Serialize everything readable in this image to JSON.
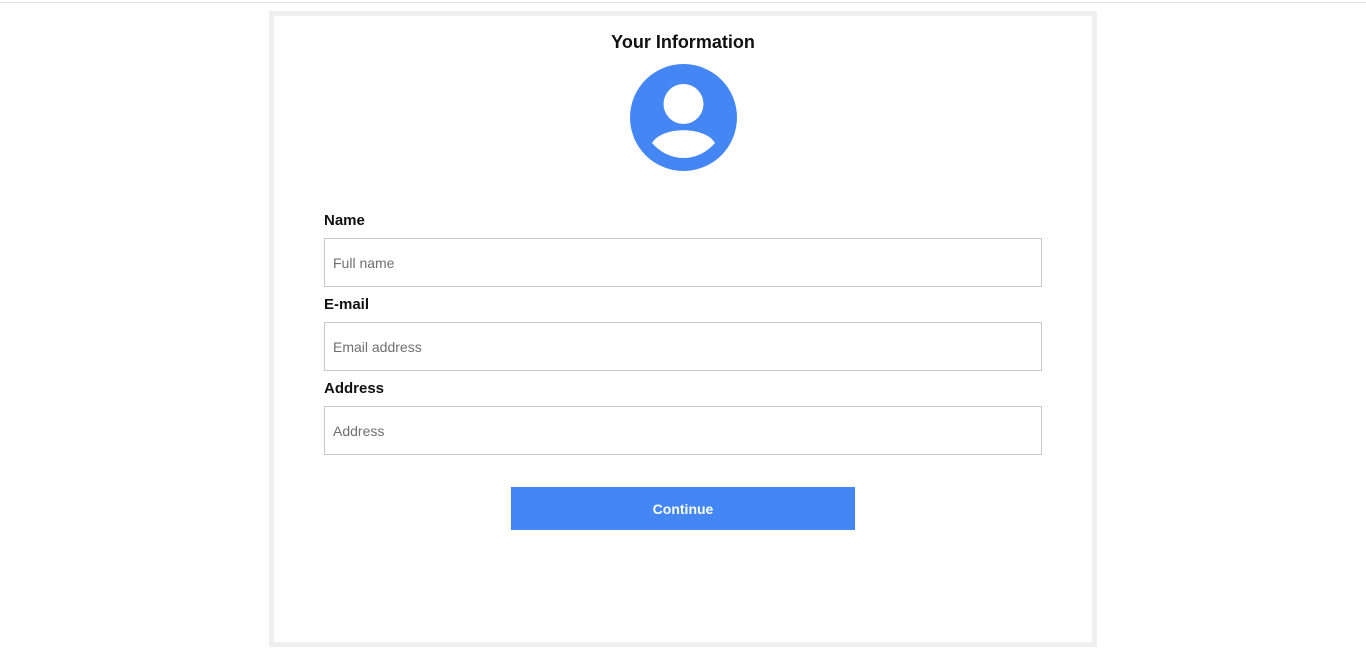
{
  "form": {
    "title": "Your Information",
    "avatar_icon": "user-avatar-icon",
    "accent_color": "#4487f4",
    "fields": [
      {
        "label": "Name",
        "placeholder": "Full name",
        "value": ""
      },
      {
        "label": "E-mail",
        "placeholder": "Email address",
        "value": ""
      },
      {
        "label": "Address",
        "placeholder": "Address",
        "value": ""
      }
    ],
    "submit_label": "Continue"
  }
}
